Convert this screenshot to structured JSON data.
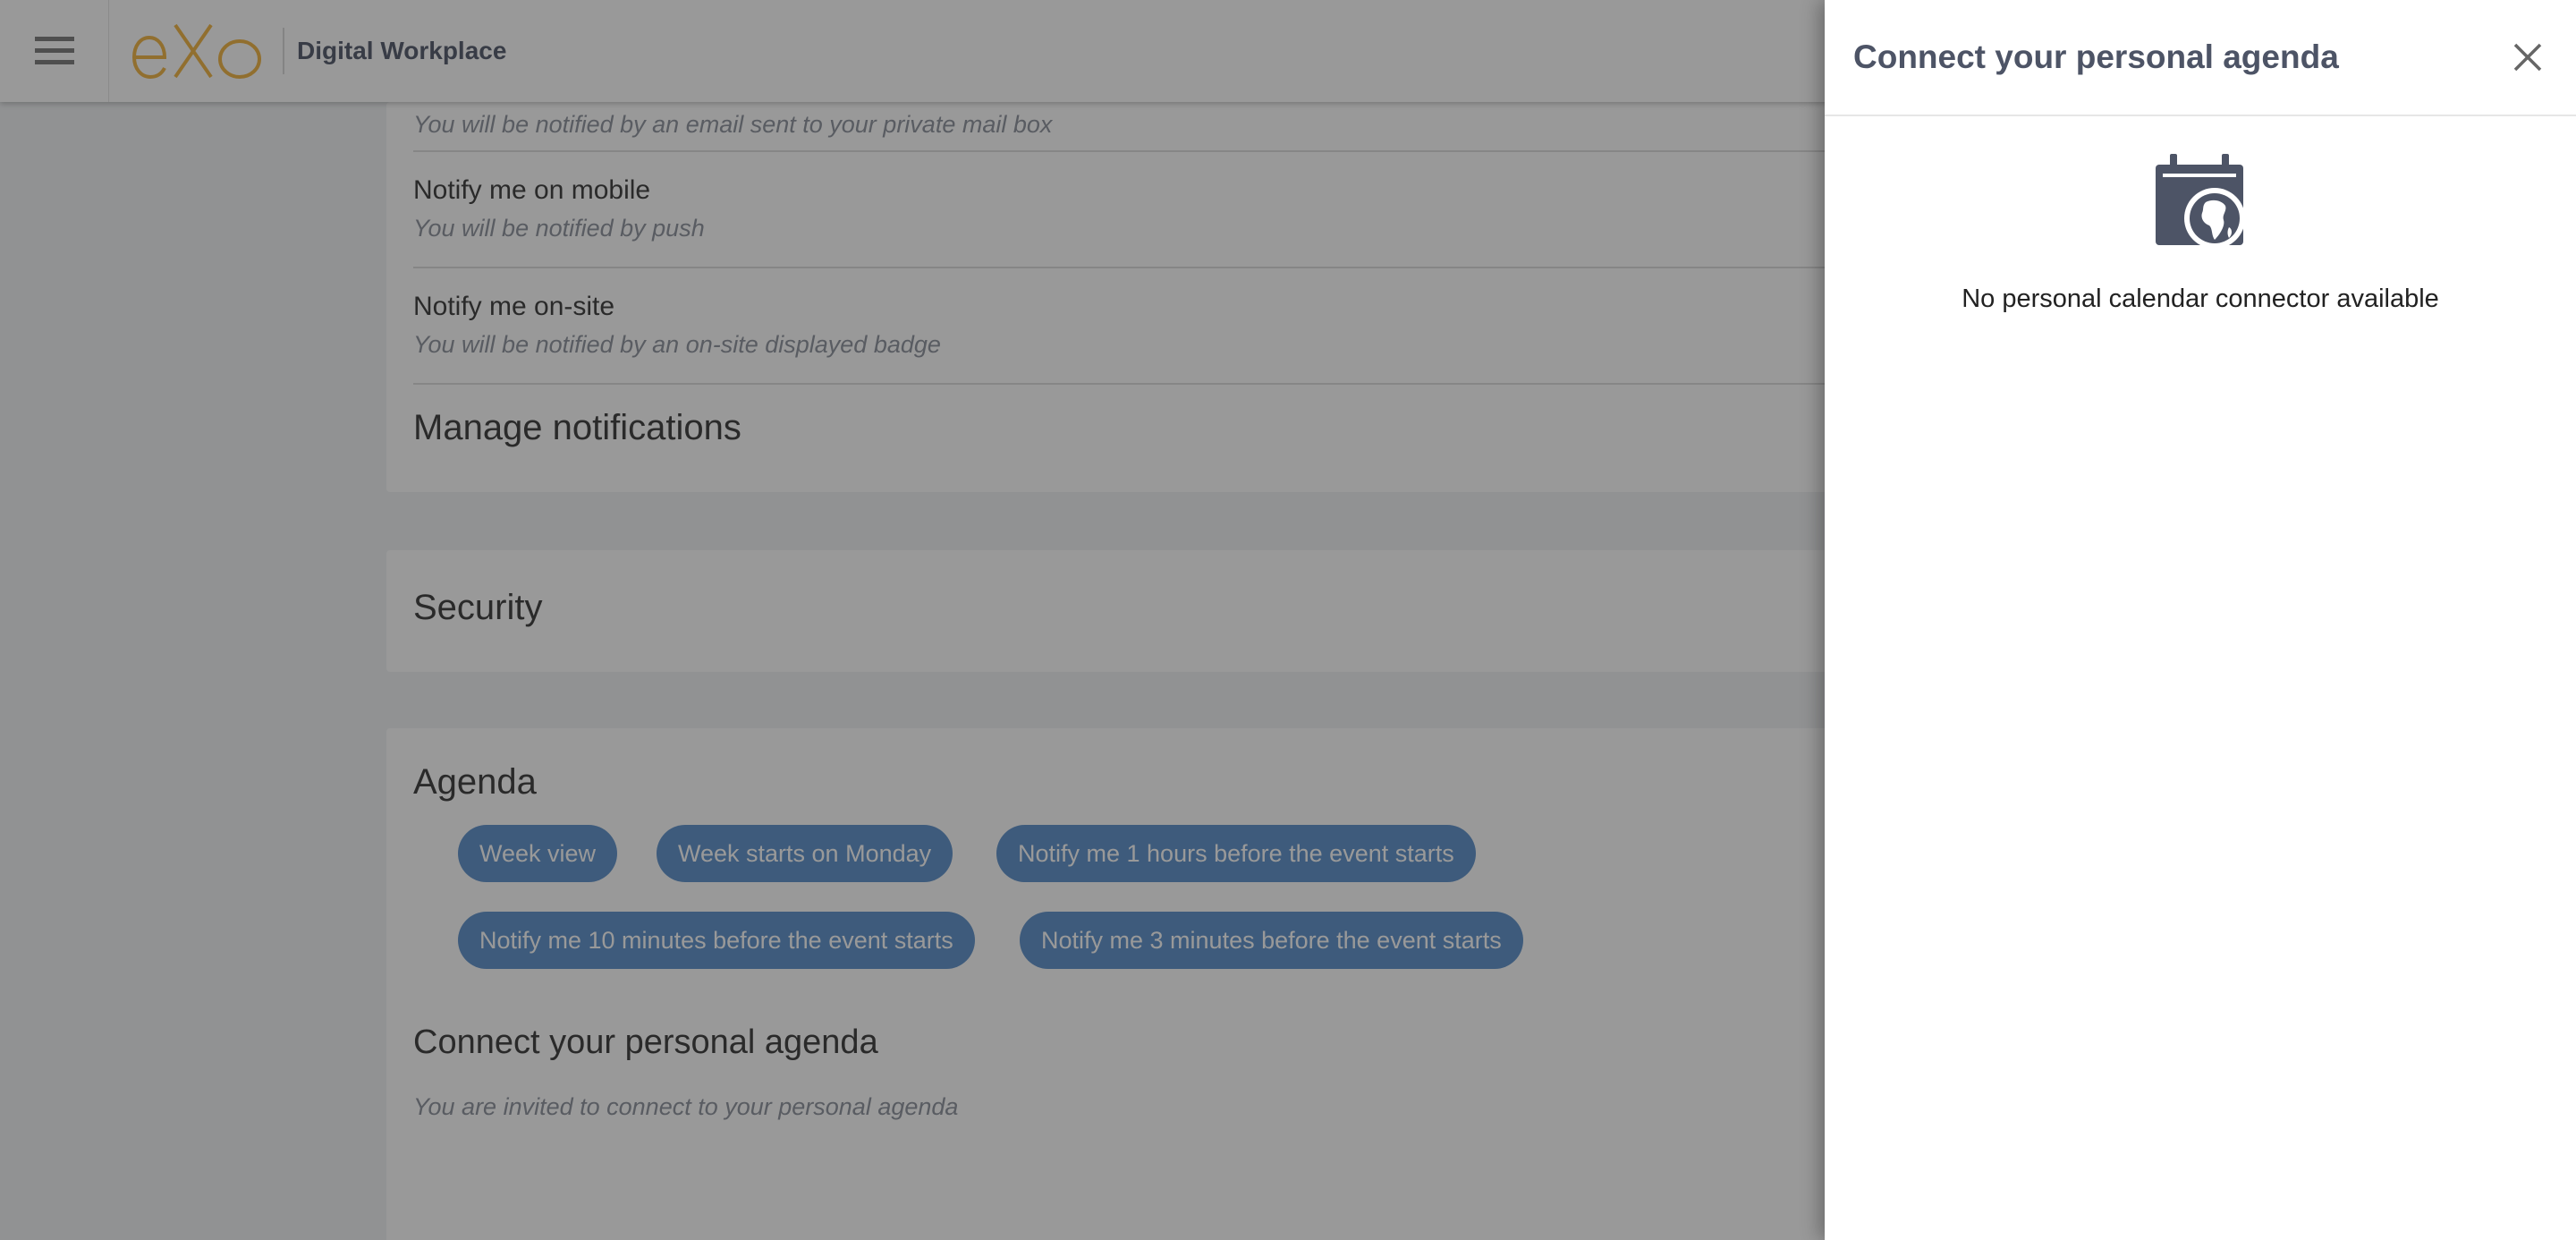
{
  "header": {
    "brand": "Digital Workplace"
  },
  "notifications": {
    "email_sub": "You will be notified by an email sent to your private mail box",
    "mobile_title": "Notify me on mobile",
    "mobile_sub": "You will be notified by push",
    "onsite_title": "Notify me on-site",
    "onsite_sub": "You will be notified by an on-site displayed badge",
    "manage_title": "Manage notifications"
  },
  "security": {
    "title": "Security"
  },
  "agenda": {
    "title": "Agenda",
    "chips": [
      "Week view",
      "Week starts on Monday",
      "Notify me 1 hours before the event starts",
      "Notify me 10 minutes before the event starts",
      "Notify me 3 minutes before the event starts"
    ],
    "connect_title": "Connect your personal agenda",
    "connect_sub": "You are invited to connect to your personal agenda"
  },
  "drawer": {
    "title": "Connect your personal agenda",
    "empty_message": "No personal calendar connector available",
    "icon": "calendar-globe-icon"
  },
  "colors": {
    "chip": "#578dc9",
    "brand_text": "#4d5466",
    "logo": "#f0b23c"
  }
}
